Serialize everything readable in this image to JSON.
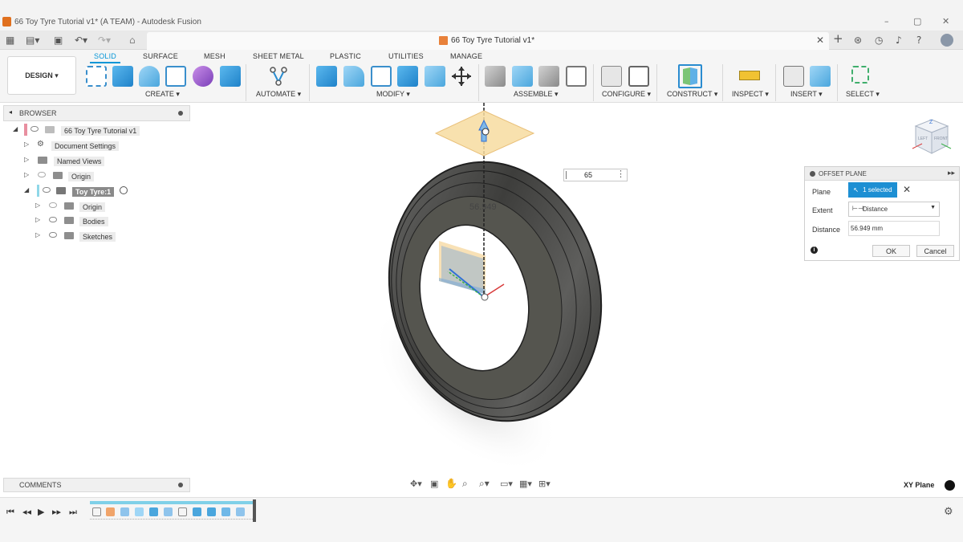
{
  "window": {
    "title": "66 Toy Tyre Tutorial v1* (A TEAM) - Autodesk Fusion",
    "minimize": "–",
    "restore": "▢",
    "close": "✕"
  },
  "tabbar": {
    "doc_title": "66 Toy Tyre Tutorial v1*",
    "doc_close": "✕"
  },
  "toolbar": {
    "workspace": "DESIGN ▾",
    "tabs": [
      "SOLID",
      "SURFACE",
      "MESH",
      "SHEET METAL",
      "PLASTIC",
      "UTILITIES",
      "MANAGE"
    ],
    "groups": [
      "CREATE ▾",
      "AUTOMATE ▾",
      "MODIFY ▾",
      "ASSEMBLE ▾",
      "CONFIGURE ▾",
      "CONSTRUCT ▾",
      "INSPECT ▾",
      "INSERT ▾",
      "SELECT ▾"
    ]
  },
  "browser": {
    "header": "BROWSER",
    "items": [
      {
        "label": "66 Toy Tyre Tutorial v1"
      },
      {
        "label": "Document Settings"
      },
      {
        "label": "Named Views"
      },
      {
        "label": "Origin"
      },
      {
        "label": "Toy Tyre:1"
      },
      {
        "label": "Origin"
      },
      {
        "label": "Bodies"
      },
      {
        "label": "Sketches"
      }
    ]
  },
  "viewport": {
    "distance_label": "56.949",
    "input_value": "65"
  },
  "dialog": {
    "title": "OFFSET PLANE",
    "plane_label": "Plane",
    "plane_value": "1 selected",
    "extent_label": "Extent",
    "extent_value": "Distance",
    "distance_label": "Distance",
    "distance_value": "56.949 mm",
    "ok": "OK",
    "cancel": "Cancel"
  },
  "viewcube": {
    "front": "FRONT",
    "left": "LEFT",
    "axis": "Z"
  },
  "comments": {
    "header": "COMMENTS"
  },
  "status": {
    "plane": "XY Plane"
  },
  "colors": {
    "accent": "#0696d7",
    "selection_blue": "#1d8fd3",
    "plane_orange": "#f7dca0",
    "tyre": "#4a4a48"
  }
}
